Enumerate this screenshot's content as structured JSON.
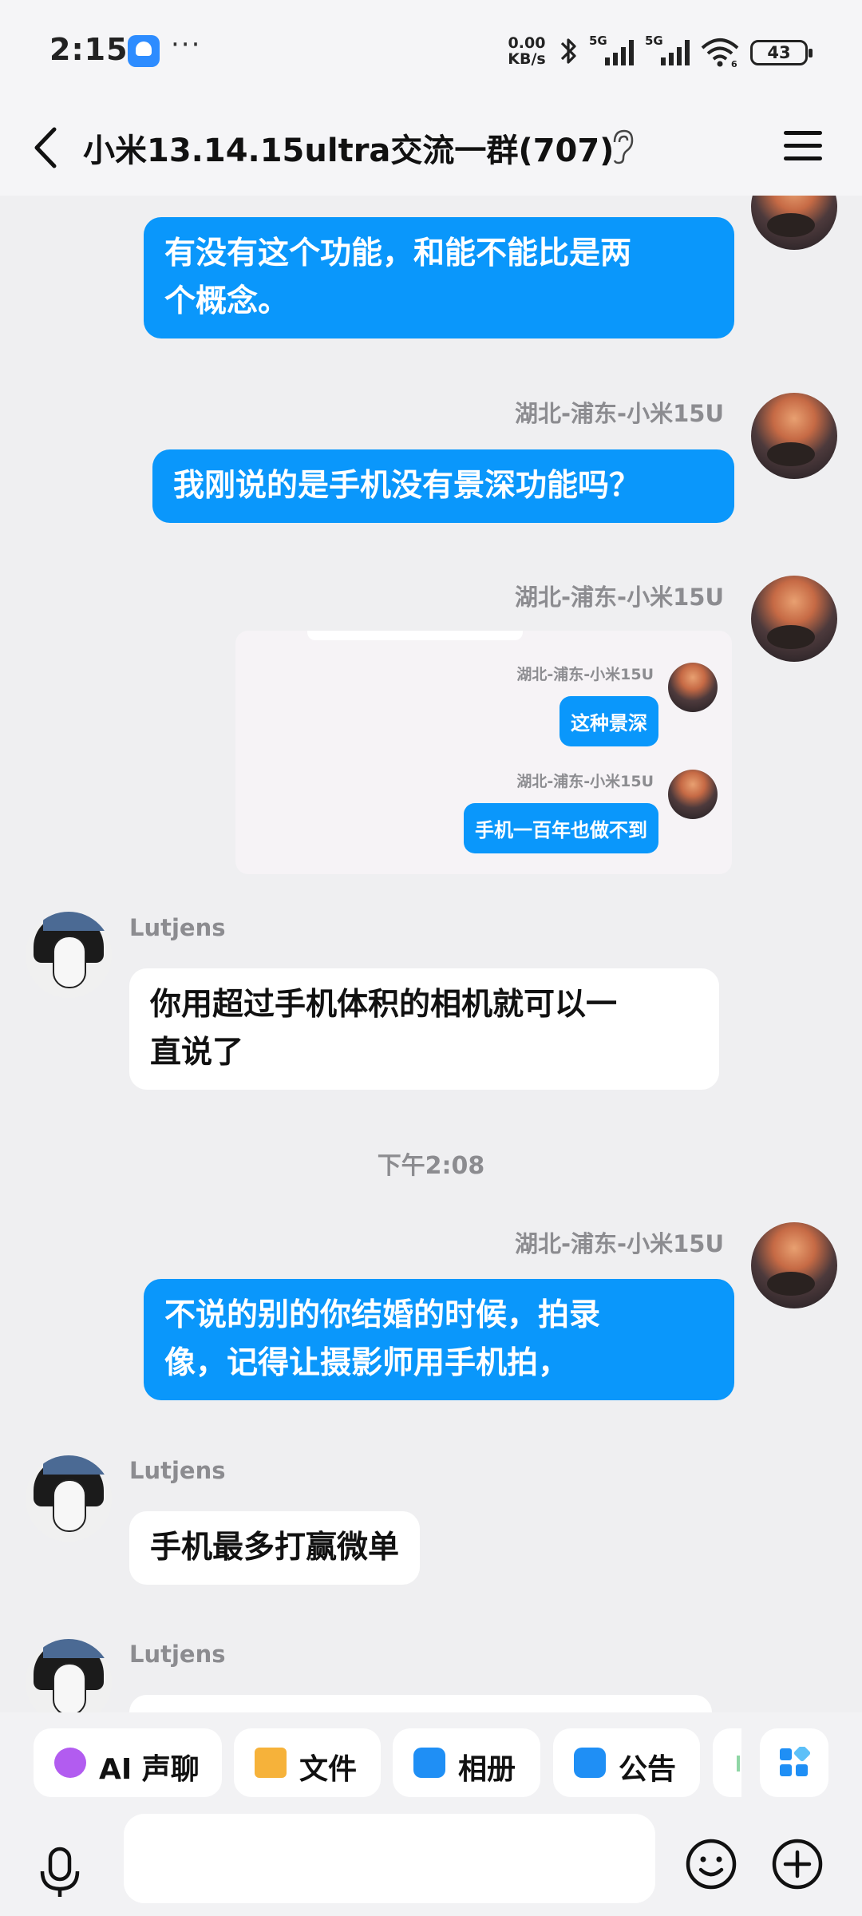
{
  "status_bar": {
    "time": "2:15",
    "dots": "···",
    "net_speed_value": "0.00",
    "net_speed_unit": "KB/s",
    "signal1": "5G",
    "signal2": "5G",
    "wifi_label": "6",
    "battery": "43"
  },
  "header": {
    "title": "小米13.14.15ultra交流一群(707)",
    "icons": [
      "back-arrow-icon",
      "ear-icon",
      "menu-icon"
    ]
  },
  "messages": {
    "m1": {
      "text_line1": "有没有这个功能，和能不能比是两",
      "text_line2": "个概念。"
    },
    "m2": {
      "sender": "湖北-浦东-小米15U",
      "text": "我刚说的是手机没有景深功能吗？"
    },
    "m3": {
      "sender": "湖北-浦东-小米15U",
      "quote": {
        "sender1": "湖北-浦东-小米15U",
        "text1": "这种景深",
        "sender2": "湖北-浦东-小米15U",
        "text2": "手机一百年也做不到"
      }
    },
    "m4": {
      "sender": "Lutjens",
      "text_line1": "你用超过手机体积的相机就可以一",
      "text_line2": "直说了"
    },
    "timestamp": "下午2:08",
    "m5": {
      "sender": "湖北-浦东-小米15U",
      "text_line1": "不说的别的你结婚的时候，拍录",
      "text_line2": "像，记得让摄影师用手机拍，"
    },
    "m6": {
      "sender": "Lutjens",
      "text": "手机最多打赢微单"
    },
    "m7": {
      "sender": "Lutjens"
    }
  },
  "quick_actions": [
    {
      "label": "AI 声聊",
      "icon": "ai-voice-icon",
      "color": "#b25cf0"
    },
    {
      "label": "文件",
      "icon": "folder-icon",
      "color": "#f6b23a"
    },
    {
      "label": "相册",
      "icon": "album-icon",
      "color": "#1f8ff5"
    },
    {
      "label": "公告",
      "icon": "announcement-icon",
      "color": "#1f8ff5"
    }
  ],
  "colors": {
    "bubble_self": "#0a97fb",
    "bubble_other": "#ffffff",
    "background": "#efeff1"
  }
}
